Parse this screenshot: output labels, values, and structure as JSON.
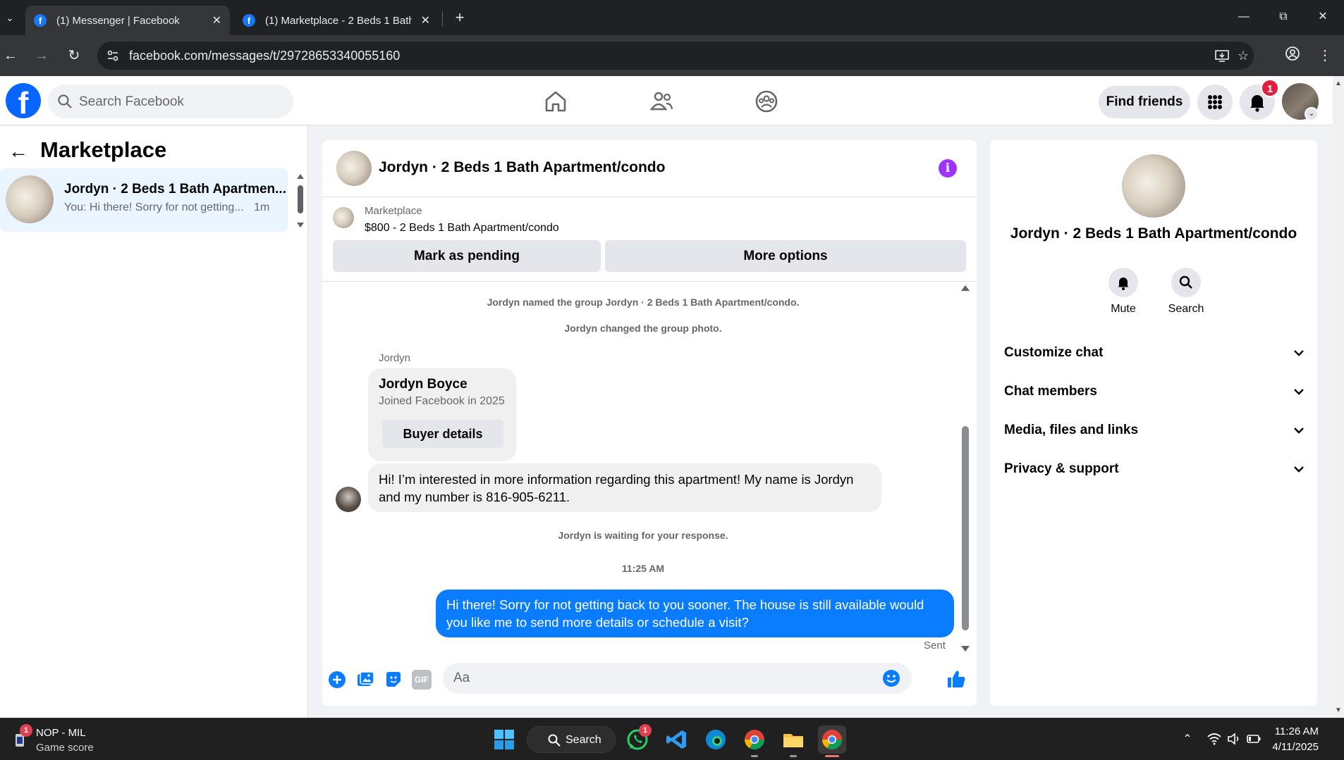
{
  "browser": {
    "tabs": [
      {
        "title": "(1) Messenger | Facebook",
        "active": true
      },
      {
        "title": "(1) Marketplace - 2 Beds 1 Bath",
        "active": false
      }
    ],
    "url": "facebook.com/messages/t/29728653340055160"
  },
  "fb_header": {
    "logo": "f",
    "search_placeholder": "Search Facebook",
    "find_friends_label": "Find friends",
    "notification_count": "1"
  },
  "sidebar": {
    "title": "Marketplace",
    "conversations": [
      {
        "name": "Jordyn · 2 Beds 1 Bath Apartmen...",
        "snippet": "You: Hi there! Sorry for not getting...",
        "time": "1m"
      }
    ]
  },
  "chat": {
    "title": "Jordyn · 2 Beds 1 Bath Apartment/condo",
    "marketplace_label": "Marketplace",
    "listing": "$800 - 2 Beds 1 Bath Apartment/condo",
    "mark_pending_label": "Mark as pending",
    "more_options_label": "More options",
    "system_messages": [
      "Jordyn named the group Jordyn · 2 Beds 1 Bath Apartment/condo.",
      "Jordyn changed the group photo."
    ],
    "sender_name": "Jordyn",
    "profile_card": {
      "name": "Jordyn Boyce",
      "joined": "Joined Facebook in 2025",
      "button_label": "Buyer details"
    },
    "incoming_message": "Hi! I’m interested in more information regarding this apartment! My name is Jordyn and my number is 816-905-6211.",
    "waiting_text": "Jordyn is waiting for your response.",
    "timestamp": "11:25 AM",
    "outgoing_message": "Hi there! Sorry for not getting back to you sooner. The house is still available would you like me to send more details or schedule a visit?",
    "sent_label": "Sent",
    "composer_placeholder": "Aa",
    "gif_label": "GIF"
  },
  "details_panel": {
    "name": "Jordyn · 2 Beds 1 Bath Apartment/condo",
    "mute_label": "Mute",
    "search_label": "Search",
    "sections": [
      "Customize chat",
      "Chat members",
      "Media, files and links",
      "Privacy & support"
    ]
  },
  "taskbar": {
    "widget_title": "NOP - MIL",
    "widget_subtitle": "Game score",
    "widget_badge": "1",
    "search_label": "Search",
    "whatsapp_badge": "1",
    "time": "11:26 AM",
    "date": "4/11/2025"
  },
  "colors": {
    "fb_blue": "#0866ff",
    "messenger_blue": "#0a7cff",
    "info_purple": "#a033ff",
    "badge_red": "#e41e3f"
  }
}
